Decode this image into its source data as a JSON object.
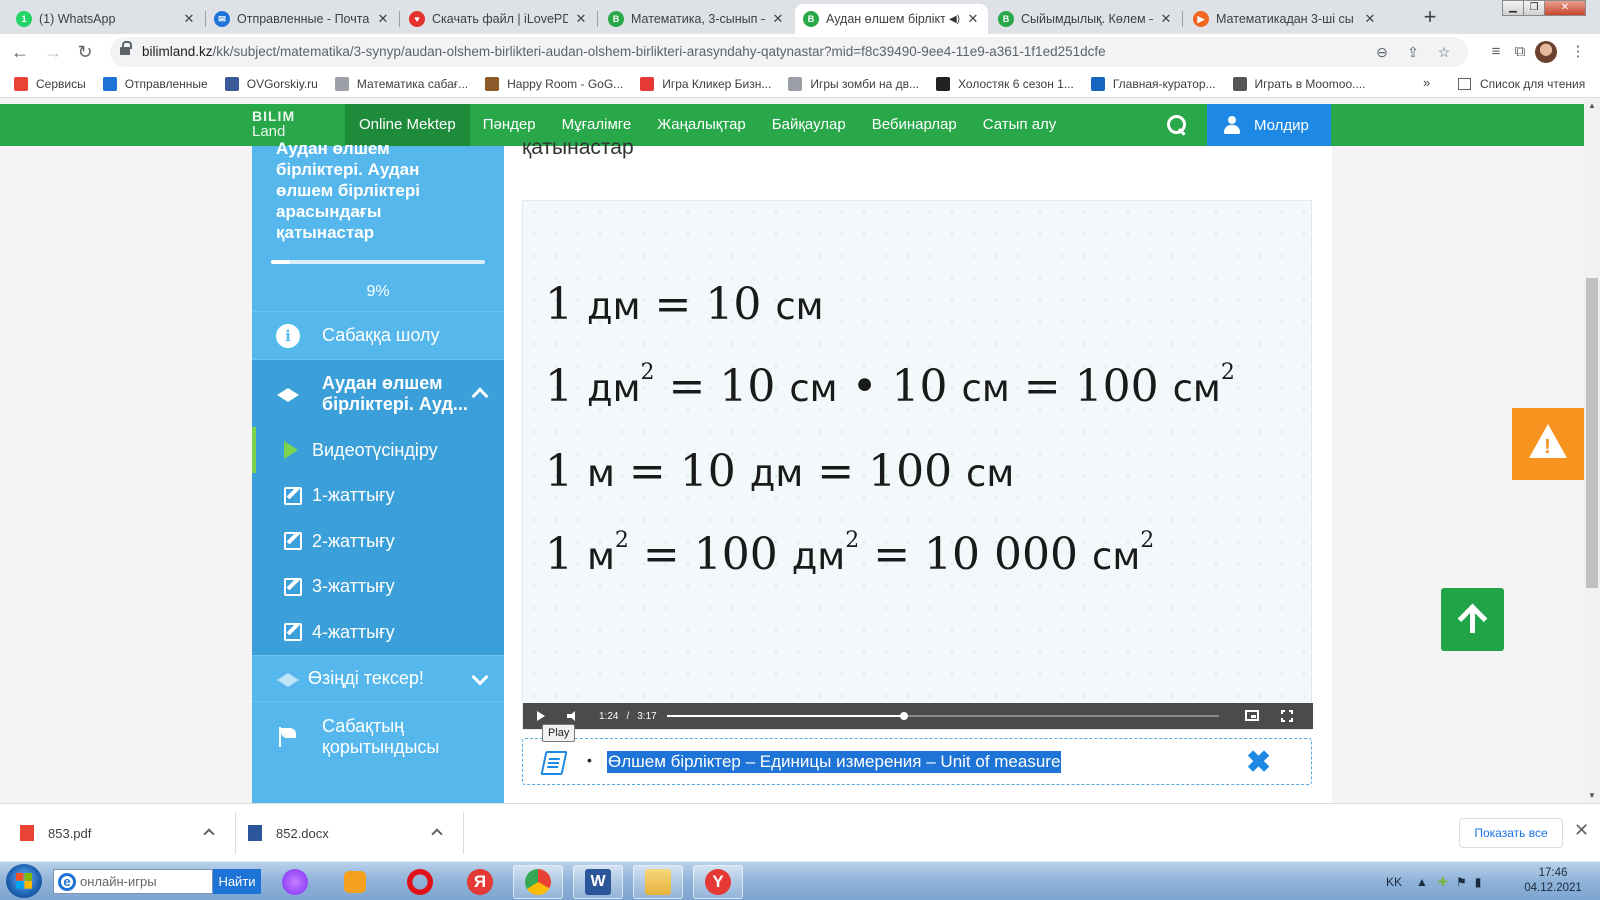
{
  "browser": {
    "tabs": [
      {
        "title": "(1) WhatsApp",
        "favicon_color": "#25D366",
        "favicon_text": "1"
      },
      {
        "title": "Отправленные - Почта M",
        "favicon_color": "#1e73d6",
        "favicon_text": "✉"
      },
      {
        "title": "Скачать файл | iLovePDF",
        "favicon_color": "#e5322d",
        "favicon_text": "♥"
      },
      {
        "title": "Математика, 3-сынып –",
        "favicon_color": "#29a84a",
        "favicon_text": "B"
      },
      {
        "title": "Аудан өлшем бірлікт",
        "favicon_color": "#29a84a",
        "favicon_text": "B",
        "active": true
      },
      {
        "title": "Сыйымдылық. Көлем – M",
        "favicon_color": "#29a84a",
        "favicon_text": "B"
      },
      {
        "title": "Математикадан 3-ші сы",
        "favicon_color": "#f26522",
        "favicon_text": "▶"
      }
    ],
    "new_tab": "+",
    "url_host": "bilimland.kz",
    "url_path": "/kk/subject/matematika/3-synyp/audan-olshem-birlikteri-audan-olshem-birlikteri-arasyndahy-qatynastar?mid=f8c39490-9ee4-11e9-a361-1f1ed251dcfe",
    "bookmarks": [
      {
        "label": "Сервисы",
        "color": "#ea4335"
      },
      {
        "label": "Отправленные",
        "color": "#1e73d6"
      },
      {
        "label": "OVGorskiy.ru",
        "color": "#3b5998"
      },
      {
        "label": "Математика сабағ...",
        "color": "#9aa0a6"
      },
      {
        "label": "Happy Room - GoG...",
        "color": "#8b5a2b"
      },
      {
        "label": "Игра Кликер Бизн...",
        "color": "#e53935"
      },
      {
        "label": "Игры зомби на дв...",
        "color": "#9aa0a6"
      },
      {
        "label": "Холостяк 6 сезон 1...",
        "color": "#222222"
      },
      {
        "label": "Главная-куратор...",
        "color": "#1565c0"
      },
      {
        "label": "Играть в Moomoo....",
        "color": "#555555"
      }
    ],
    "bookmarks_more": "»",
    "reading_list": "Список для чтения"
  },
  "site": {
    "logo_line1": "BILIM",
    "logo_line2": "Land",
    "nav": [
      "Online Mektep",
      "Пәндер",
      "Мұғалімге",
      "Жаңалықтар",
      "Байқаулар",
      "Вебинарлар",
      "Сатып алу"
    ],
    "user_name": "Молдир"
  },
  "sidebar": {
    "title": "Аудан өлшем бірліктері. Аудан өлшем бірліктері арасындағы қатынастар",
    "progress_percent": 9,
    "progress_label": "9%",
    "overview": "Сабаққа шолу",
    "section": "Аудан өлшем бірліктері. Ауд...",
    "items": [
      "Видеотүсіндіру",
      "1-жаттығу",
      "2-жаттығу",
      "3-жаттығу",
      "4-жаттығу"
    ],
    "self_check": "Өзіңді тексер!",
    "conclusion": "Сабақтың қорытындысы"
  },
  "content": {
    "title": "қатынастар",
    "formulas": [
      {
        "parts": [
          "1 ",
          "дм",
          " = 10 ",
          "см"
        ]
      },
      {
        "parts": [
          "1 ",
          "дм",
          "² = 10 ",
          "см",
          " • 10 ",
          "см",
          " = 100 ",
          "см",
          "²"
        ]
      },
      {
        "parts": [
          "1 ",
          "м",
          " = 10 ",
          "дм",
          " = 100 ",
          "см"
        ]
      },
      {
        "parts": [
          "1 ",
          "м",
          "² = 100 ",
          "дм",
          "² = 10 000 ",
          "см",
          "²"
        ]
      }
    ],
    "video": {
      "current": "1:24",
      "separator": "/",
      "duration": "3:17",
      "progress_fraction": 0.43,
      "tooltip": "Play"
    },
    "glossary_bullet": "•",
    "glossary": "Өлшем бірліктер – Единицы измерения – Unit of measure"
  },
  "downloads": {
    "files": [
      {
        "name": "853.pdf",
        "color": "#ea4335"
      },
      {
        "name": "852.docx",
        "color": "#2b579a"
      }
    ],
    "show_all": "Показать все"
  },
  "taskbar": {
    "search_placeholder": "онлайн-игры",
    "search_button": "Найти",
    "tray_lang": "KK",
    "time": "17:46",
    "date": "04.12.2021"
  }
}
